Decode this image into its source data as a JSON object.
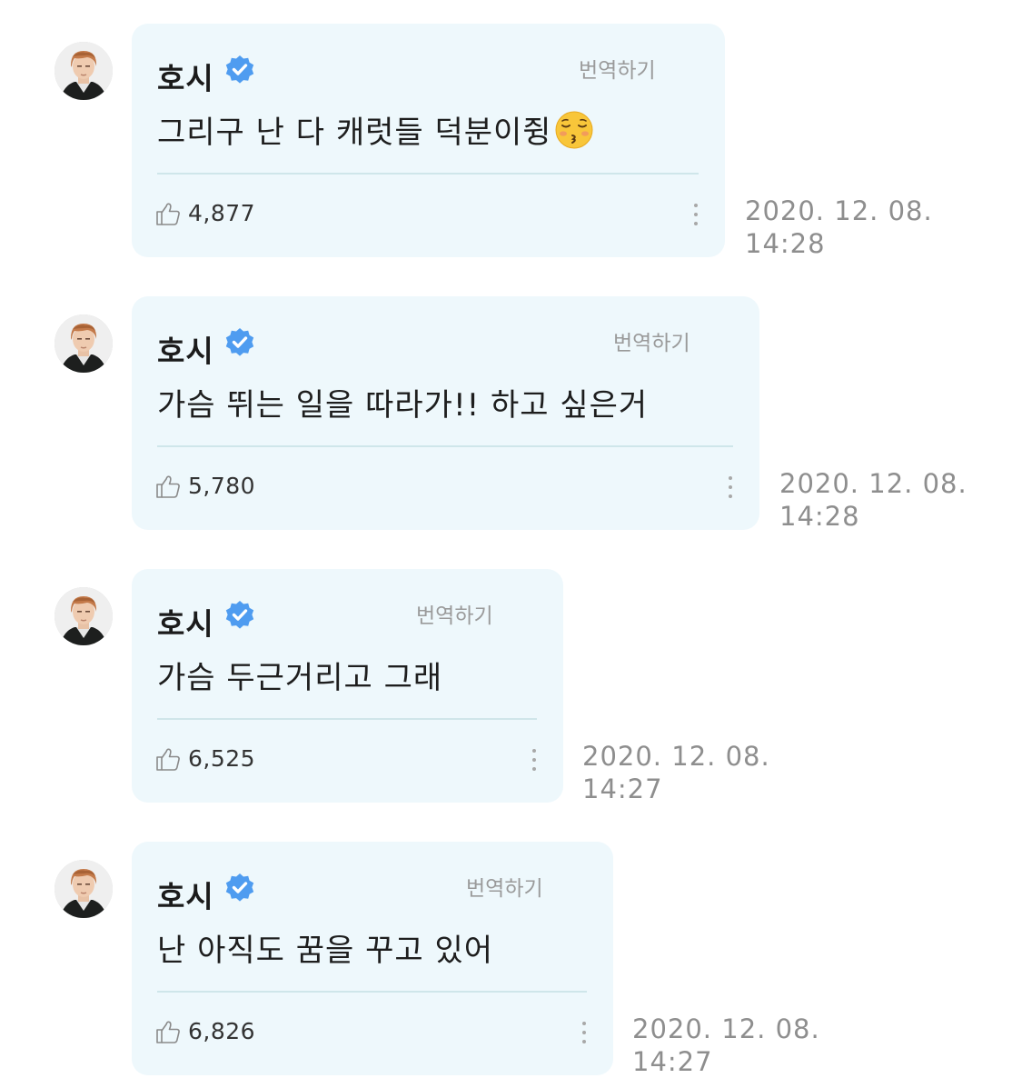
{
  "messages": [
    {
      "author": "호시",
      "translate_label": "번역하기",
      "text": "그리구 난 다 캐럿들 덕분이쥥",
      "emoji": "kissing-face-with-closed-eyes",
      "likes": "4,877",
      "date": "2020. 12. 08.",
      "time": "14:28"
    },
    {
      "author": "호시",
      "translate_label": "번역하기",
      "text": "가슴 뛰는 일을 따라가!! 하고 싶은거",
      "likes": "5,780",
      "date": "2020. 12. 08.",
      "time": "14:28"
    },
    {
      "author": "호시",
      "translate_label": "번역하기",
      "text": "가슴 두근거리고 그래",
      "likes": "6,525",
      "date": "2020. 12. 08.",
      "time": "14:27"
    },
    {
      "author": "호시",
      "translate_label": "번역하기",
      "text": "난 아직도 꿈을 꾸고 있어",
      "likes": "6,826",
      "date": "2020. 12. 08.",
      "time": "14:27"
    }
  ],
  "colors": {
    "bubble": "#eef8fc",
    "verified": "#4f9cf0",
    "divider": "#cfe6ea"
  }
}
